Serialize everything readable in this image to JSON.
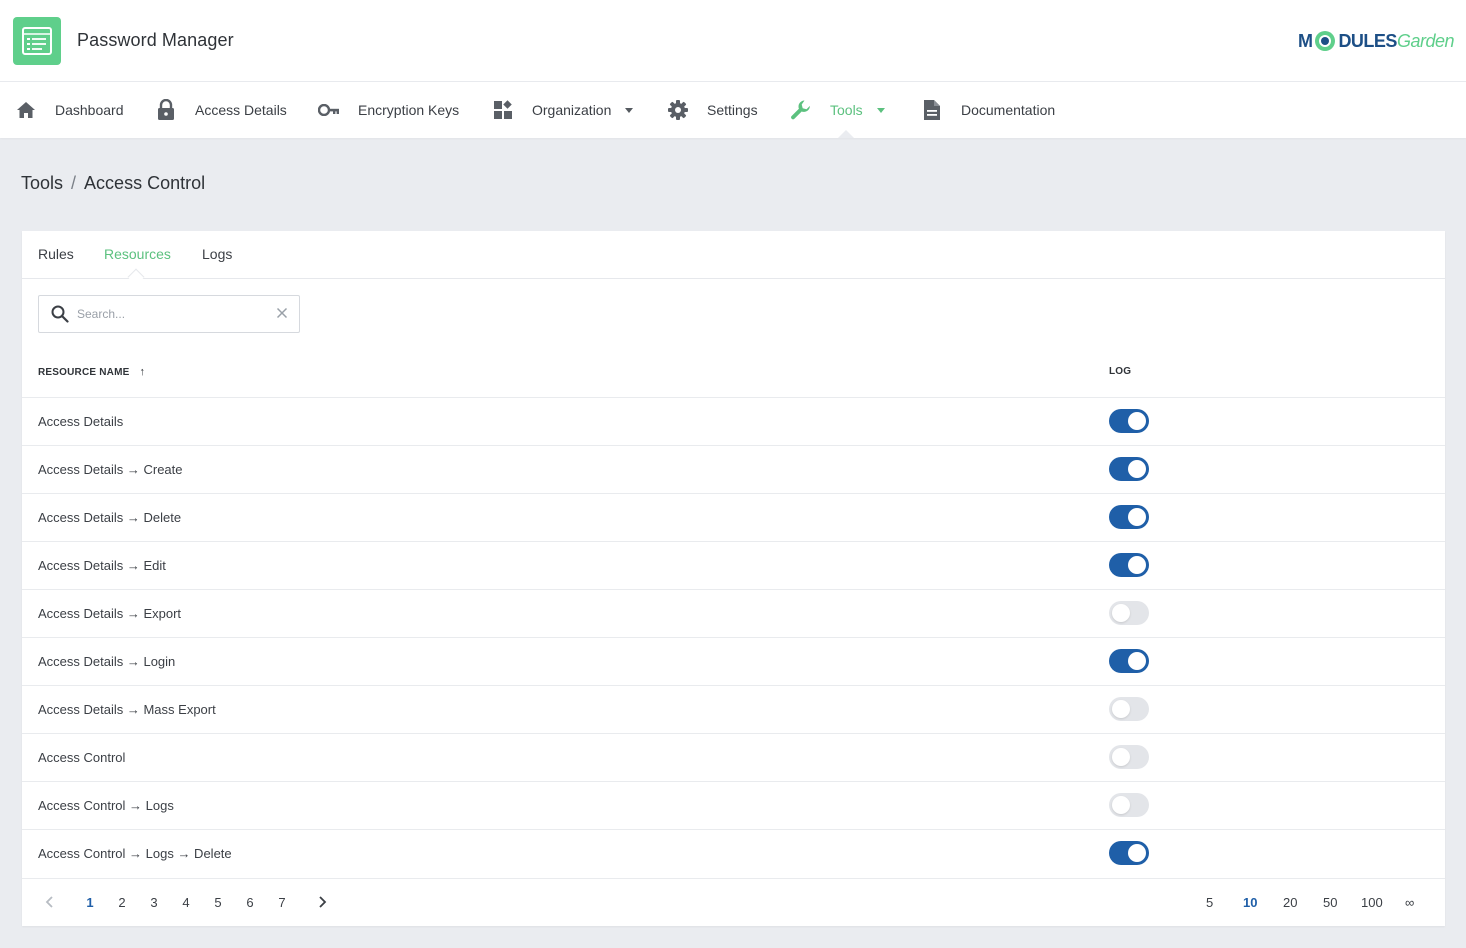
{
  "app": {
    "title": "Password Manager",
    "brand_part1": "M",
    "brand_part2": "DULES",
    "brand_part3": "Garden"
  },
  "nav": {
    "items": [
      {
        "label": "Dashboard",
        "icon": "home-icon"
      },
      {
        "label": "Access Details",
        "icon": "lock-icon"
      },
      {
        "label": "Encryption Keys",
        "icon": "key-icon"
      },
      {
        "label": "Organization",
        "icon": "widgets-icon",
        "dropdown": true
      },
      {
        "label": "Settings",
        "icon": "gear-icon"
      },
      {
        "label": "Tools",
        "icon": "wrench-icon",
        "dropdown": true,
        "active": true
      },
      {
        "label": "Documentation",
        "icon": "document-icon"
      }
    ]
  },
  "breadcrumb": {
    "parent": "Tools",
    "separator": "/",
    "current": "Access Control"
  },
  "tabs": [
    {
      "label": "Rules"
    },
    {
      "label": "Resources",
      "active": true
    },
    {
      "label": "Logs"
    }
  ],
  "search": {
    "placeholder": "Search...",
    "value": ""
  },
  "table": {
    "columns": {
      "name": "RESOURCE NAME",
      "sort_arrow": "↑",
      "log": "LOG"
    },
    "rows": [
      {
        "name": "Access Details",
        "log": true
      },
      {
        "name": "Access Details → Create",
        "log": true
      },
      {
        "name": "Access Details → Delete",
        "log": true
      },
      {
        "name": "Access Details → Edit",
        "log": true
      },
      {
        "name": "Access Details → Export",
        "log": false
      },
      {
        "name": "Access Details → Login",
        "log": true
      },
      {
        "name": "Access Details → Mass Export",
        "log": false
      },
      {
        "name": "Access Control",
        "log": false
      },
      {
        "name": "Access Control → Logs",
        "log": false
      },
      {
        "name": "Access Control → Logs → Delete",
        "log": true
      }
    ]
  },
  "pagination": {
    "pages": [
      "1",
      "2",
      "3",
      "4",
      "5",
      "6",
      "7"
    ],
    "current_page": "1",
    "page_sizes": [
      "5",
      "10",
      "20",
      "50",
      "100",
      "∞"
    ],
    "current_size": "10"
  },
  "colors": {
    "accent_green": "#5cc17f",
    "toggle_on": "#1f5fa8",
    "toggle_off": "#e3e5e9",
    "background": "#eaecf0"
  }
}
